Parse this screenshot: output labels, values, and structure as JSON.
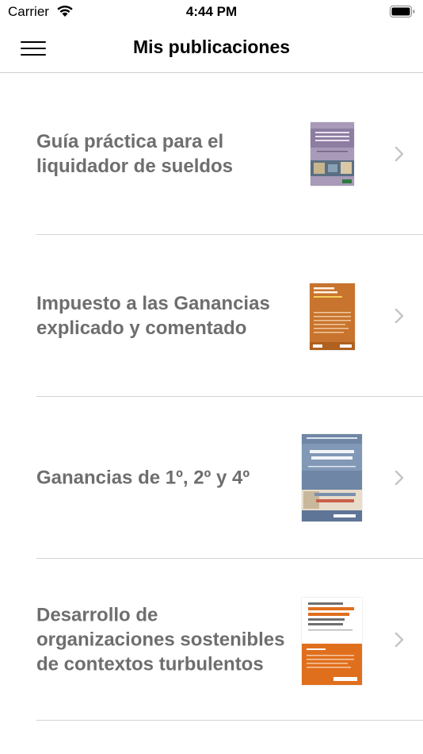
{
  "status_bar": {
    "carrier": "Carrier",
    "time": "4:44 PM"
  },
  "nav": {
    "title": "Mis publicaciones",
    "menu_icon": "hamburger-menu-icon"
  },
  "publications": [
    {
      "title": "Guía práctica para el liquidador de sueldos",
      "cover_color": "#a89ab8"
    },
    {
      "title": "Impuesto a las Ganancias explicado y comentado",
      "cover_color": "#c8742e"
    },
    {
      "title": "Ganancias de 1º, 2º y 4º",
      "cover_color": "#6f86a6"
    },
    {
      "title": "Desarrollo de organizaciones sostenibles de contextos turbulentos",
      "cover_color": "#e06f1d"
    }
  ],
  "icons": {
    "row_chevron": "chevron-right-icon"
  }
}
